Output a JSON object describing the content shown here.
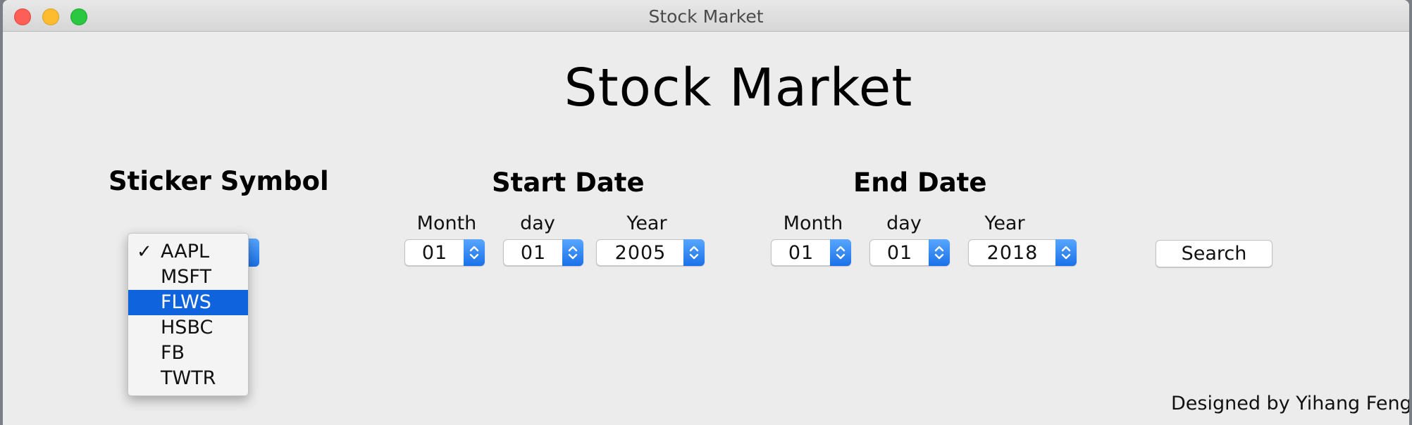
{
  "window": {
    "title": "Stock Market"
  },
  "headline": "Stock Market",
  "sticker": {
    "title": "Sticker Symbol",
    "options": [
      "AAPL",
      "MSFT",
      "FLWS",
      "HSBC",
      "FB",
      "TWTR"
    ],
    "checked": "AAPL",
    "highlighted": "FLWS",
    "check_mark": "✓"
  },
  "start_date": {
    "title": "Start Date",
    "month_label": "Month",
    "day_label": "day",
    "year_label": "Year",
    "month": "01",
    "day": "01",
    "year": "2005"
  },
  "end_date": {
    "title": "End Date",
    "month_label": "Month",
    "day_label": "day",
    "year_label": "Year",
    "month": "01",
    "day": "01",
    "year": "2018"
  },
  "search_label": "Search",
  "footer": "Designed by Yihang Feng",
  "colors": {
    "accent": "#1a71e8",
    "selection": "#0f64dd",
    "window_bg": "#ececec"
  }
}
